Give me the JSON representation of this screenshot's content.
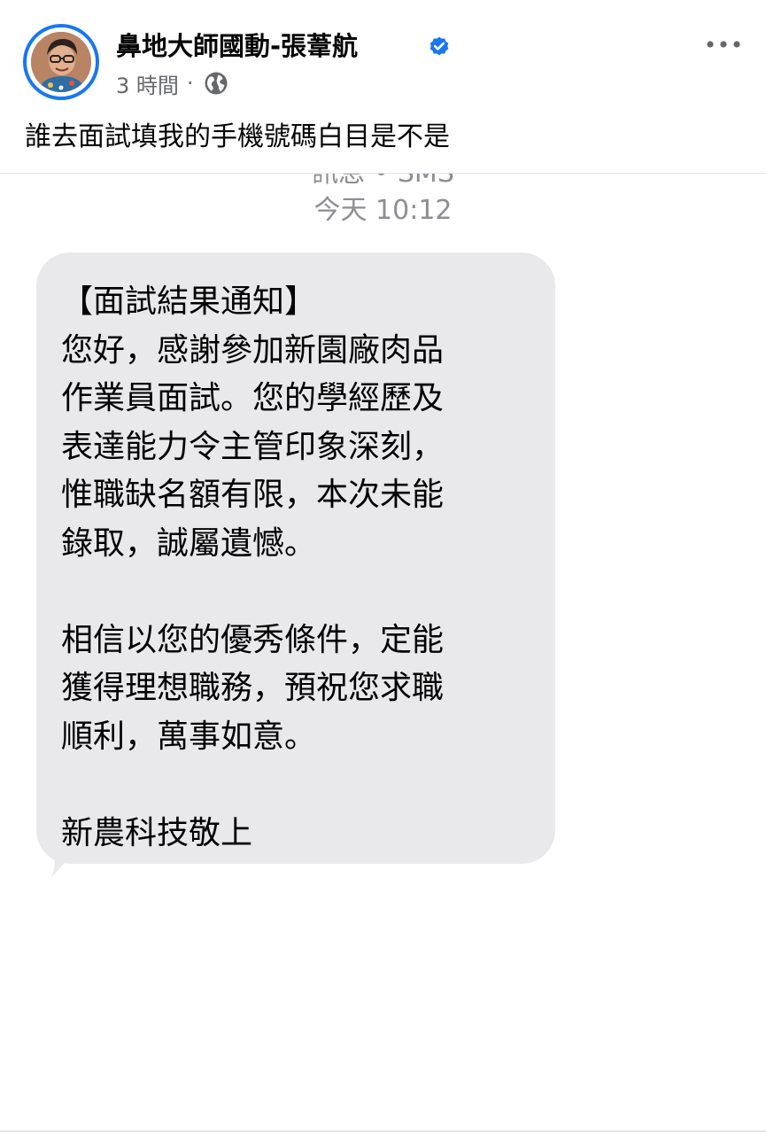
{
  "post": {
    "author_name": "鼻地大師國動-張葦航",
    "time": "3 時間",
    "separator": "·",
    "text": "誰去面試填我的手機號碼白目是不是",
    "icons": {
      "verified": "verified-badge-icon",
      "audience": "globe-icon",
      "more": "more-options-icon"
    },
    "accent_color": "#1877f2"
  },
  "sms": {
    "header": "訊息 • SMS",
    "time": "今天 10:12",
    "lines": [
      "【面試結果通知】",
      "您好，感謝參加新園廠肉品",
      "作業員面試。您的學經歷及",
      "表達能力令主管印象深刻，",
      "惟職缺名額有限，本次未能",
      "錄取，誠屬遺憾。",
      "",
      "相信以您的優秀條件，定能",
      "獲得理想職務，預祝您求職",
      "順利，萬事如意。",
      "",
      "新農科技敬上"
    ],
    "bubble_color": "#e9e9eb"
  }
}
